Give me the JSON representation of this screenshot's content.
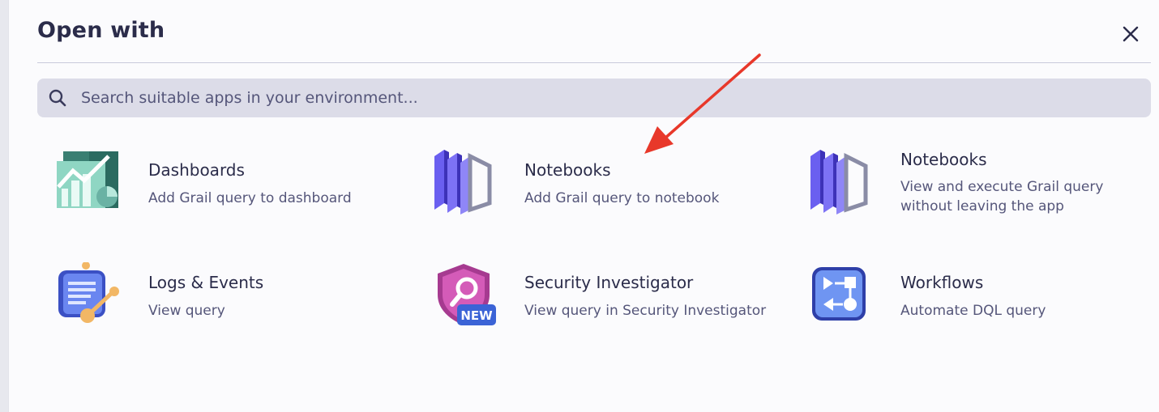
{
  "dialog": {
    "title": "Open with"
  },
  "search": {
    "placeholder": "Search suitable apps in your environment..."
  },
  "apps": [
    {
      "name": "Dashboards",
      "description": "Add Grail query to dashboard",
      "icon": "dashboards-icon"
    },
    {
      "name": "Notebooks",
      "description": "Add Grail query to notebook",
      "icon": "notebooks-icon"
    },
    {
      "name": "Notebooks",
      "description": "View and execute Grail query without leaving the app",
      "icon": "notebooks-icon"
    },
    {
      "name": "Logs & Events",
      "description": "View query",
      "icon": "logs-events-icon"
    },
    {
      "name": "Security Investigator",
      "description": "View query in Security Investigator",
      "icon": "security-investigator-icon",
      "badge": "NEW"
    },
    {
      "name": "Workflows",
      "description": "Automate DQL query",
      "icon": "workflows-icon"
    }
  ],
  "colors": {
    "accent": "#5b4fd6",
    "annotation_arrow": "#e8382a",
    "badge": "#3b63d6"
  }
}
